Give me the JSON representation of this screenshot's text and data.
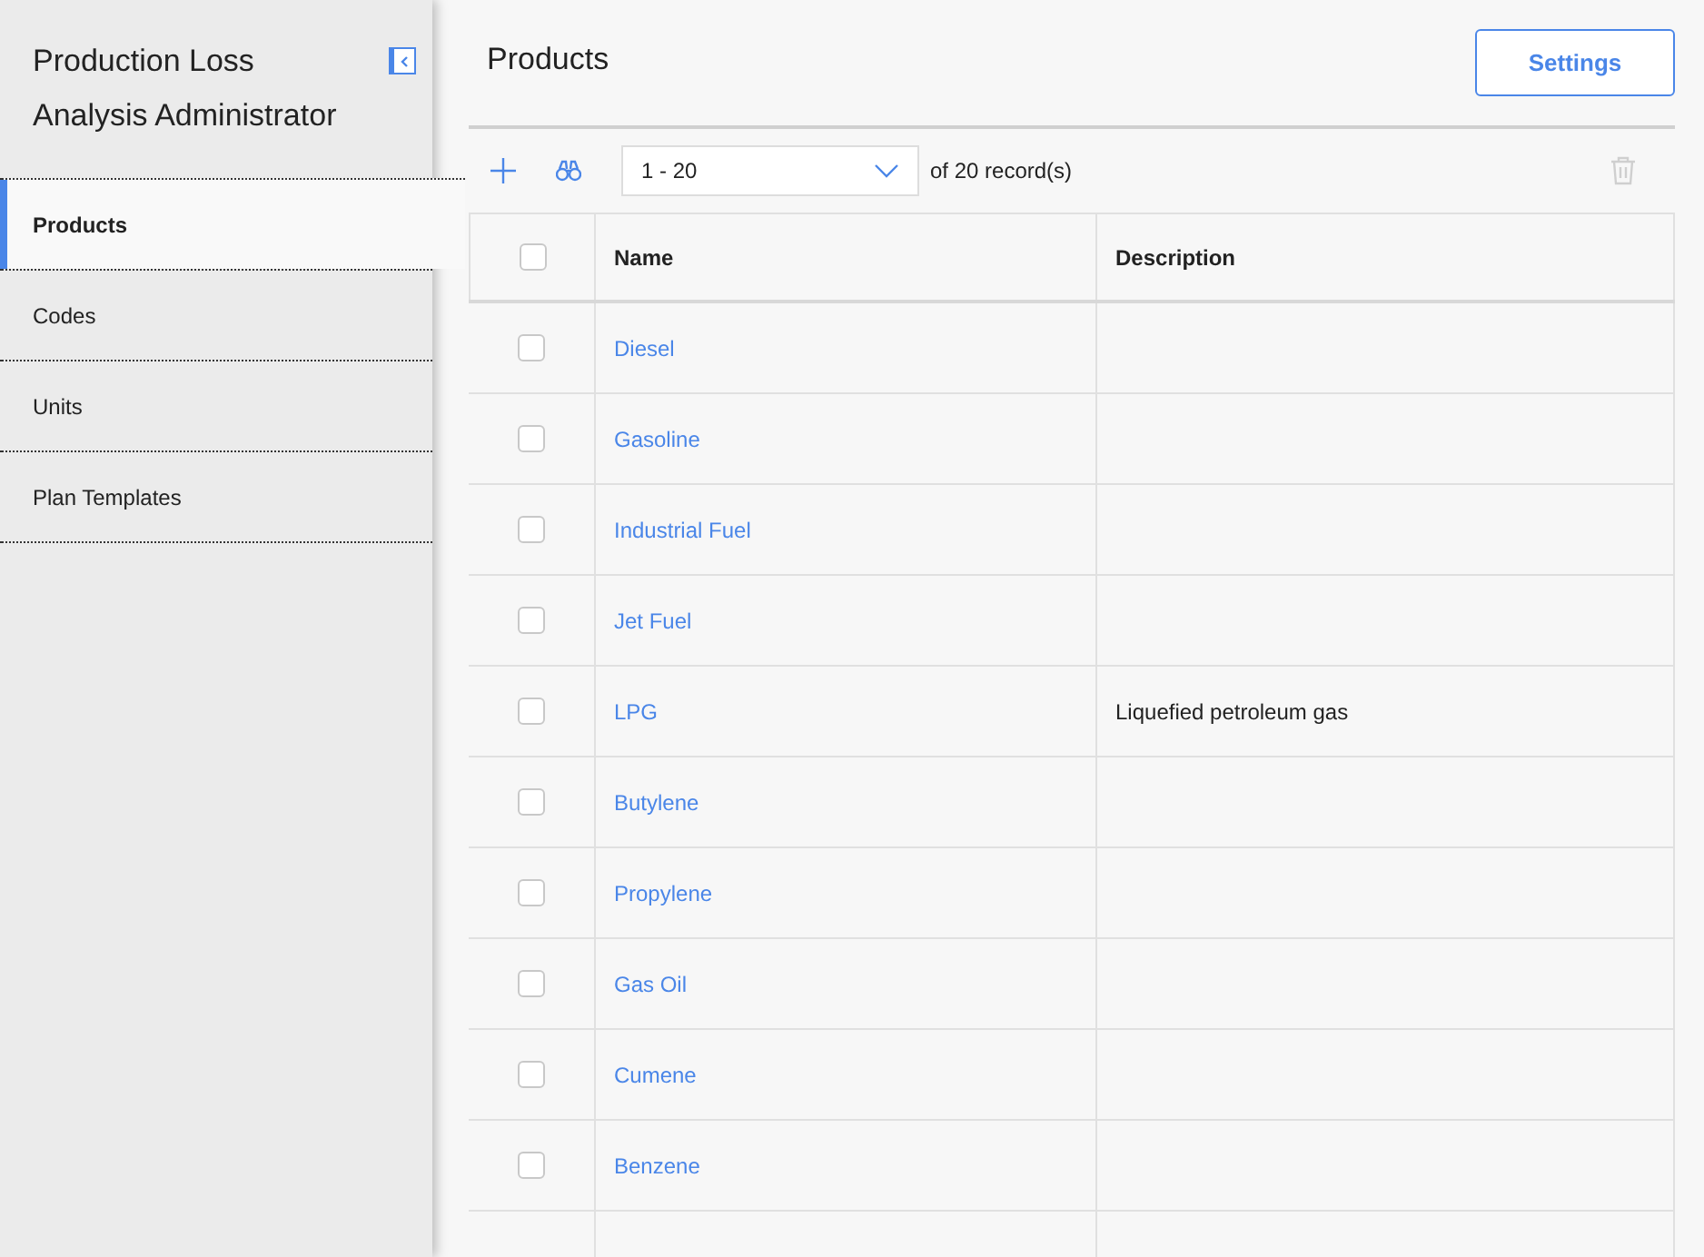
{
  "sidebar": {
    "title": "Production Loss Analysis Administrator",
    "items": [
      {
        "label": "Products",
        "selected": true
      },
      {
        "label": "Codes",
        "selected": false
      },
      {
        "label": "Units",
        "selected": false
      },
      {
        "label": "Plan Templates",
        "selected": false
      }
    ]
  },
  "page": {
    "title": "Products",
    "settings_button": "Settings"
  },
  "toolbar": {
    "range": "1 - 20",
    "record_count": "of 20 record(s)"
  },
  "table": {
    "columns": [
      "Name",
      "Description"
    ],
    "header_checked": false,
    "rows": [
      {
        "name": "Diesel",
        "description": "",
        "checked": false
      },
      {
        "name": "Gasoline",
        "description": "",
        "checked": false
      },
      {
        "name": "Industrial Fuel",
        "description": "",
        "checked": false
      },
      {
        "name": "Jet Fuel",
        "description": "",
        "checked": false
      },
      {
        "name": "LPG",
        "description": "Liquefied petroleum gas",
        "checked": false
      },
      {
        "name": "Butylene",
        "description": "",
        "checked": false
      },
      {
        "name": "Propylene",
        "description": "",
        "checked": false
      },
      {
        "name": "Gas Oil",
        "description": "",
        "checked": false
      },
      {
        "name": "Cumene",
        "description": "",
        "checked": false
      },
      {
        "name": "Benzene",
        "description": "",
        "checked": false
      }
    ]
  }
}
